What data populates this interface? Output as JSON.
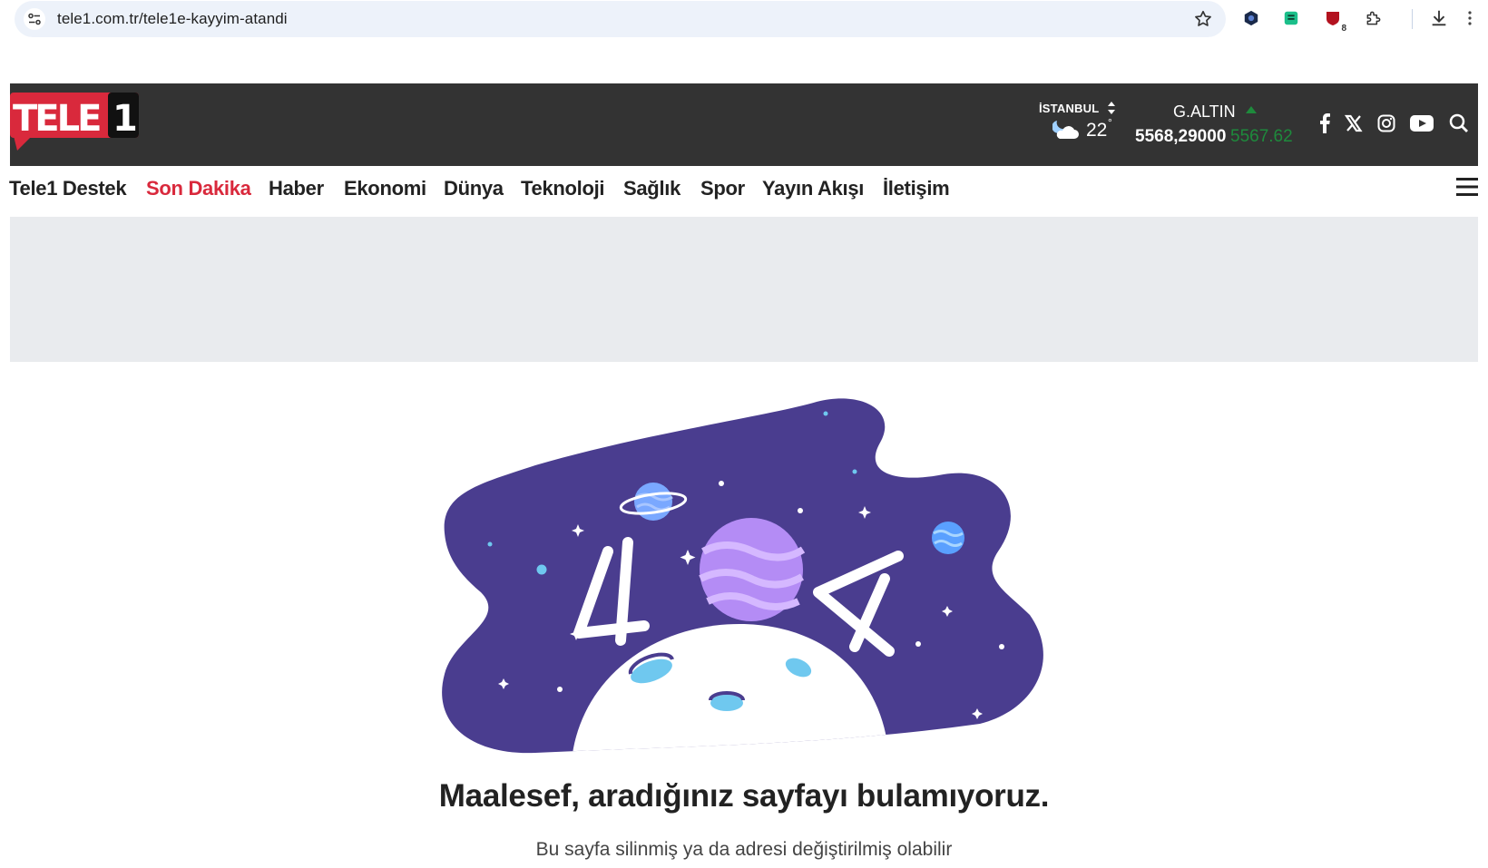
{
  "browser": {
    "url": "tele1.com.tr/tele1e-kayyim-atandi",
    "extension_badge": "8"
  },
  "header": {
    "logo_text": "TELE1",
    "weather": {
      "city": "İSTANBUL",
      "temperature": "22",
      "degree": "°"
    },
    "gold": {
      "label": "G.ALTIN",
      "value": "5568,29000",
      "previous": "5567.62",
      "trend": "up"
    },
    "social": [
      "facebook-icon",
      "x-icon",
      "instagram-icon",
      "youtube-icon"
    ],
    "colors": {
      "header_bg": "#333333",
      "accent": "#d9293c",
      "gold_up": "#1e8a3c"
    }
  },
  "nav": {
    "items": [
      {
        "label": "Tele1 Destek"
      },
      {
        "label": "Son Dakika"
      },
      {
        "label": "Haber"
      },
      {
        "label": "Ekonomi"
      },
      {
        "label": "Dünya"
      },
      {
        "label": "Teknoloji"
      },
      {
        "label": "Sağlık"
      },
      {
        "label": "Spor"
      },
      {
        "label": "Yayın Akışı"
      },
      {
        "label": "İletişim"
      }
    ],
    "active": "Son Dakika"
  },
  "error": {
    "code": "404",
    "title": "Maalesef, aradığınız sayfayı bulamıyoruz.",
    "subtitle": "Bu sayfa silinmiş ya da adresi değiştirilmiş olabilir",
    "colors": {
      "space": "#4a3d8f",
      "planet": "#b48cf5",
      "moon_crater": "#6fc8ef"
    }
  }
}
